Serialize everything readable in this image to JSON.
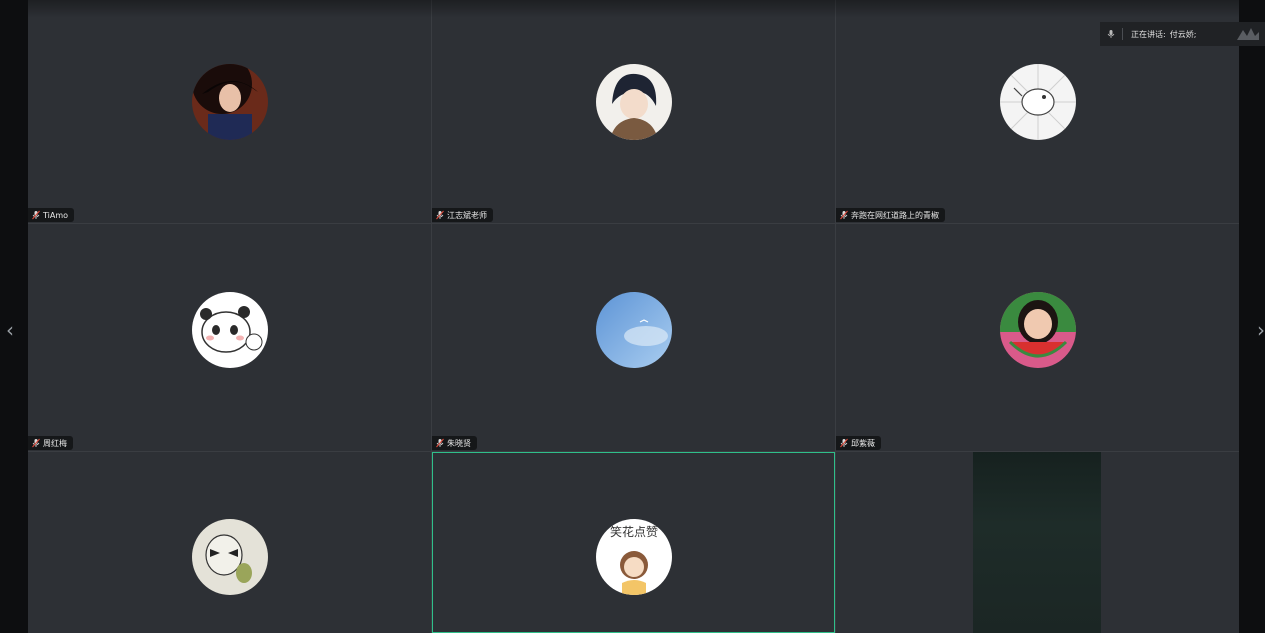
{
  "speaker": {
    "label": "正在讲话:",
    "name": "付云娇;"
  },
  "participants": [
    {
      "name": "TiAmo",
      "avatar": "woman-black-hat-portrait",
      "video": false
    },
    {
      "name": "江志斌老师",
      "avatar": "anime-boy-portrait",
      "video": false
    },
    {
      "name": "奔跑在网红道路上的青椒",
      "avatar": "sketch-bird-drawing",
      "video": false
    },
    {
      "name": "周红梅",
      "avatar": "cartoon-panda",
      "video": false
    },
    {
      "name": "朱晓贤",
      "avatar": "blue-sky-with-bird",
      "video": false
    },
    {
      "name": "邱紫薇",
      "avatar": "girl-eating-watermelon",
      "video": false
    },
    {
      "name": "",
      "avatar": "sketch-raccoon-drawing",
      "video": false
    },
    {
      "name": "",
      "avatar": "cartoon-girl-sticker",
      "video": false,
      "active": true
    },
    {
      "name": "",
      "avatar": "",
      "video": true
    }
  ],
  "avatar_sticker_text": "笑花点赞",
  "colors": {
    "tile_bg": "#2d3035",
    "active_border": "#2fbf8a",
    "name_tag_bg": "#151719"
  }
}
